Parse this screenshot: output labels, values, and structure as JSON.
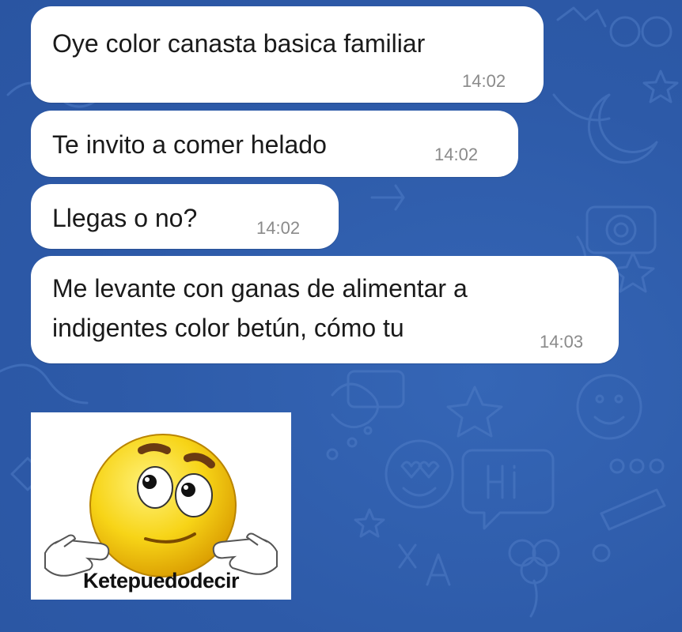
{
  "chat": {
    "messages": [
      {
        "text": "Oye color canasta basica familiar",
        "time": "14:02"
      },
      {
        "text": "Te invito a comer helado",
        "time": "14:02"
      },
      {
        "text": "Llegas o no?",
        "time": "14:02"
      },
      {
        "lines": [
          "Me levante con ganas de alimentar a",
          "indigentes color betún, cómo tu"
        ],
        "time": "14:03"
      }
    ],
    "sticker": {
      "caption": "Ketepuedodecir",
      "icon": "confused-smiley-shrug-icon"
    }
  },
  "colors": {
    "background": "#2f5eae",
    "bubble": "#ffffff",
    "time": "#8a8a8a",
    "emoji_face": "#f7d417"
  }
}
